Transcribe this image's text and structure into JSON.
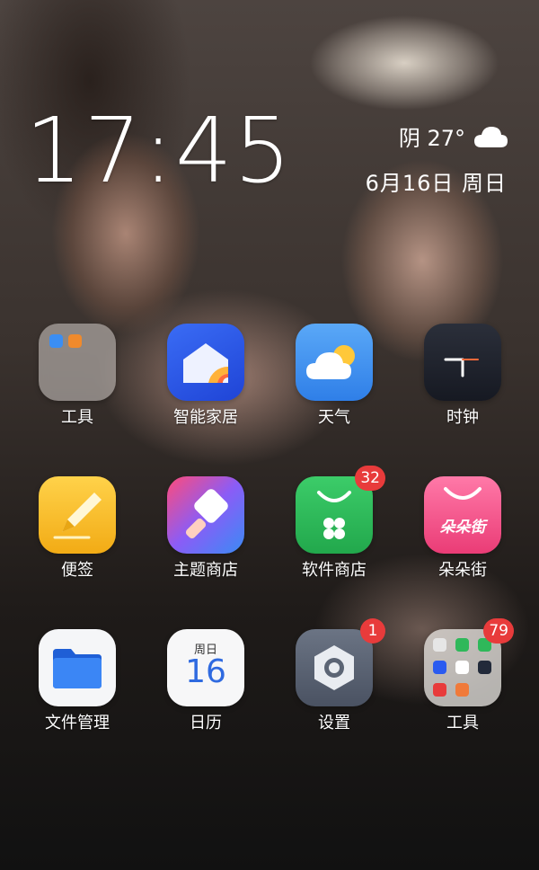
{
  "status": {
    "time": "17:45",
    "weather": "阴 27°",
    "weather_icon": "cloud-icon",
    "date": "6月16日  周日"
  },
  "apps": [
    {
      "label": "工具",
      "icon": "folder-icon"
    },
    {
      "label": "智能家居",
      "icon": "smart-home-icon"
    },
    {
      "label": "天气",
      "icon": "weather-icon"
    },
    {
      "label": "时钟",
      "icon": "clock-icon"
    },
    {
      "label": "便签",
      "icon": "notes-icon"
    },
    {
      "label": "主题商店",
      "icon": "themes-icon"
    },
    {
      "label": "软件商店",
      "icon": "app-store-icon",
      "badge": "32"
    },
    {
      "label": "朵朵街",
      "icon": "shopping-bag-icon"
    },
    {
      "label": "文件管理",
      "icon": "files-icon"
    },
    {
      "label": "日历",
      "icon": "calendar-icon"
    },
    {
      "label": "设置",
      "icon": "settings-icon",
      "badge": "1"
    },
    {
      "label": "工具",
      "icon": "folder-icon",
      "badge": "79"
    }
  ],
  "calendar": {
    "weekday": "周日",
    "day": "16"
  },
  "duoduo": {
    "text": "朵朵街"
  },
  "colors": {
    "badge": "#e83b3b",
    "smart_home": "#2a5bf0",
    "weather": "#3d8ff0",
    "notes": "#f7c12d",
    "app_store": "#2fb85a",
    "duoduo": "#f0508a",
    "files": "#2e7bf0",
    "settings": "#5b6474"
  }
}
